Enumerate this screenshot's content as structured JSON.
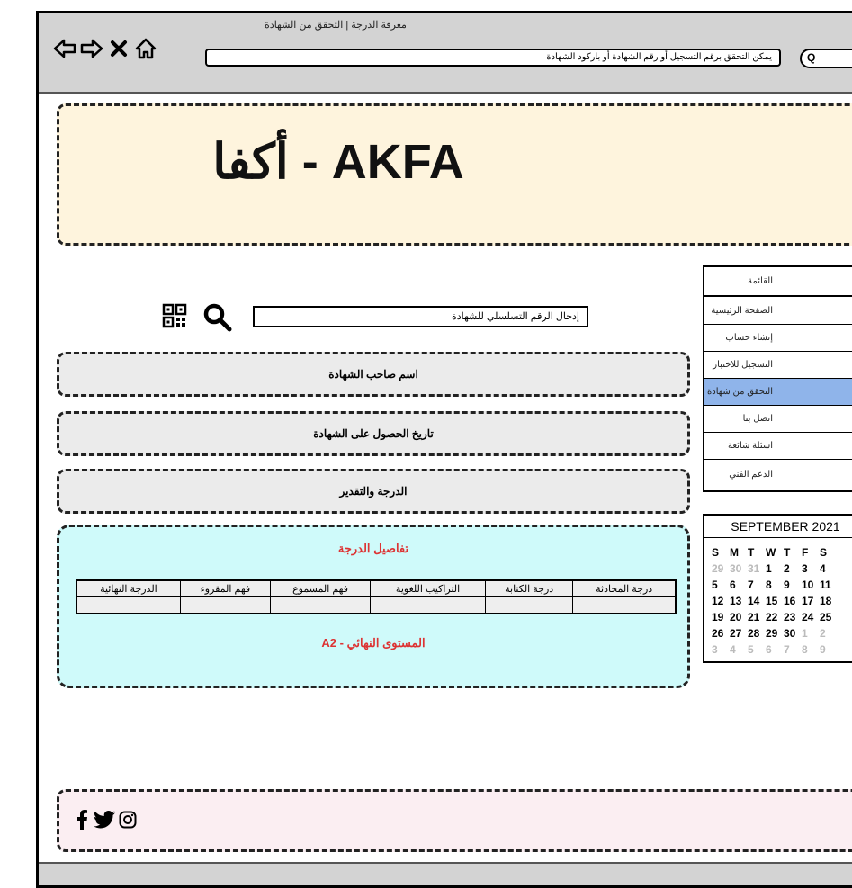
{
  "browser": {
    "window_title": "معرفة الدرجة | التحقق من الشهادة",
    "address": "يمكن التحقق برقم التسجيل أو رقم الشهادة أو باركود الشهادة",
    "search_glyph": "Q"
  },
  "header": {
    "title": "أكفا - AKFA"
  },
  "search": {
    "placeholder": "إدخال الرقم التسلسلي للشهادة"
  },
  "fields": {
    "holder_name": "اسم صاحب الشهادة",
    "issue_date": "تاريخ الحصول على الشهادة",
    "grade": "الدرجة والتقدير"
  },
  "details": {
    "title": "تفاصيل الدرجة",
    "columns": [
      "درجة المحادثة",
      "درجة الكتابة",
      "التراكيب اللغوية",
      "فهم المسموع",
      "فهم المقروء",
      "الدرجة النهائية"
    ],
    "rows": [
      [
        "",
        "",
        "",
        "",
        "",
        ""
      ]
    ],
    "final_level": "A2 - المستوى النهائي"
  },
  "menu": {
    "items": [
      "القائمة",
      "الصفحة الرئيسية",
      "إنشاء حساب",
      "التسجيل للاختبار",
      "التحقق من شهادة",
      "اتصل بنا",
      "اسئلة شائعة",
      "الدعم الفني"
    ],
    "active_index": 4
  },
  "calendar": {
    "month": "SEPTEMBER 2021",
    "dow": [
      "S",
      "M",
      "T",
      "W",
      "T",
      "F",
      "S"
    ],
    "weeks": [
      [
        "29",
        "30",
        "31",
        "1",
        "2",
        "3",
        "4"
      ],
      [
        "5",
        "6",
        "7",
        "8",
        "9",
        "10",
        "11"
      ],
      [
        "12",
        "13",
        "14",
        "15",
        "16",
        "17",
        "18"
      ],
      [
        "19",
        "20",
        "21",
        "22",
        "23",
        "24",
        "25"
      ],
      [
        "26",
        "27",
        "28",
        "29",
        "30",
        "1",
        "2"
      ],
      [
        "3",
        "4",
        "5",
        "6",
        "7",
        "8",
        "9"
      ]
    ],
    "selected_day": "5",
    "colors": {
      "selected": "#8fb4ea",
      "muted": "#bbbbbb"
    }
  },
  "footer": {
    "icons": [
      "facebook-icon",
      "twitter-icon",
      "instagram-icon"
    ]
  },
  "colors": {
    "hero_bg": "#fef4dd",
    "details_bg": "#cffafa",
    "accent_red": "#dd3333",
    "footer_bg": "#fbeef2",
    "active_menu": "#8fb4ea"
  }
}
